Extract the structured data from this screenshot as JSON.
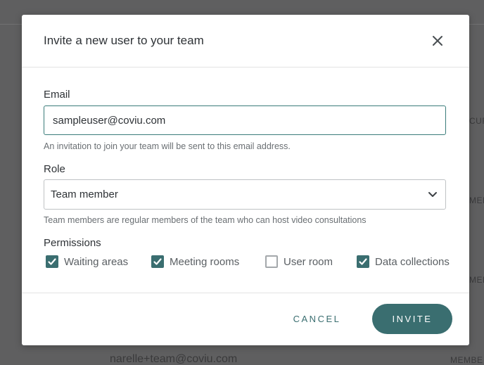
{
  "background": {
    "side_labels": [
      "CURRE",
      "MEMBE",
      "MEMBE",
      "MEMBE"
    ],
    "partial_email": "narelle+team@coviu.com"
  },
  "modal": {
    "title": "Invite a new user to your team",
    "email": {
      "label": "Email",
      "value": "sampleuser@coviu.com",
      "help": "An invitation to join your team will be sent to this email address."
    },
    "role": {
      "label": "Role",
      "selected": "Team member",
      "help": "Team members are regular members of the team who can host video consultations"
    },
    "permissions": {
      "label": "Permissions",
      "items": [
        {
          "label": "Waiting areas",
          "checked": true
        },
        {
          "label": "Meeting rooms",
          "checked": true
        },
        {
          "label": "User room",
          "checked": false
        },
        {
          "label": "Data collections",
          "checked": true
        }
      ]
    },
    "actions": {
      "cancel_label": "CANCEL",
      "invite_label": "INVITE"
    }
  },
  "colors": {
    "accent": "#3a6e70",
    "input_focus_border": "#3a7c7a",
    "overlay": "#5f5f60"
  },
  "icons": {
    "close": "close-icon",
    "dropdown": "chevron-down-icon",
    "check": "check-icon"
  }
}
